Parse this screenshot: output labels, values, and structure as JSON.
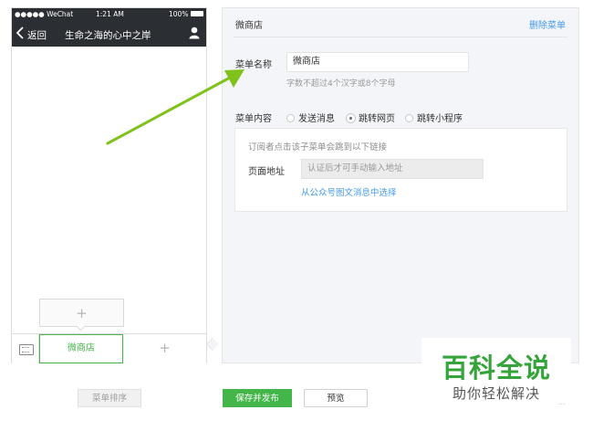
{
  "phone": {
    "status": {
      "carrier": "●●●●● WeChat",
      "time": "1:21 AM",
      "battery": "100%"
    },
    "nav": {
      "back_label": "返回",
      "title": "生命之海的心中之岸"
    },
    "menu": {
      "active_item": "微商店",
      "popup_add": "+",
      "add_symbol": "+"
    }
  },
  "editor": {
    "menu_name_title": "微商店",
    "delete_label": "删除菜单",
    "name_label": "菜单名称",
    "name_value": "微商店",
    "name_hint": "字数不超过4个汉字或8个字母",
    "content_label": "菜单内容",
    "options": [
      "发送消息",
      "跳转网页",
      "跳转小程序"
    ],
    "selected_option": "跳转网页",
    "box": {
      "description": "订阅者点击该子菜单会跳到以下链接",
      "url_label": "页面地址",
      "url_placeholder": "认证后才可手动输入地址",
      "pick_link": "从公众号图文消息中选择"
    }
  },
  "buttons": {
    "sort": "菜单排序",
    "save": "保存并发布",
    "preview": "预览"
  },
  "watermark": {
    "title": "百科全说",
    "subtitle": "助你轻松解决",
    "corner": "..."
  },
  "colors": {
    "accent_green": "#44b549",
    "link_blue": "#459ae9",
    "arrow_green": "#7fc21b",
    "phone_bar": "#2b2e33"
  }
}
